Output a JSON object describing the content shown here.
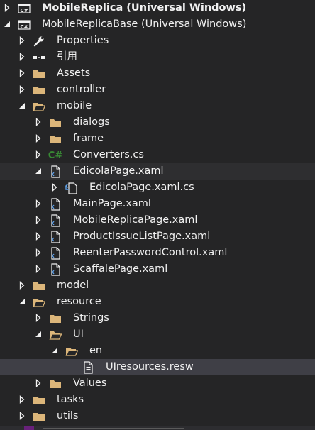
{
  "colors": {
    "background": "#252526",
    "text": "#f1f1f1",
    "folder": "#dcb67a",
    "csharp": "#68217a",
    "cs_file": "#388a34",
    "selected_row": "#3f3f46",
    "hover_row": "#2e2e30"
  },
  "tree": [
    {
      "label": "MobileReplica (Universal Windows)",
      "icon": "csharp-project-icon",
      "expander": "collapsed",
      "depth": 0,
      "bold": true
    },
    {
      "label": "MobileReplicaBase (Universal Windows)",
      "icon": "csharp-project-icon",
      "expander": "expanded",
      "depth": 0
    },
    {
      "label": "Properties",
      "icon": "wrench-icon",
      "expander": "collapsed",
      "depth": 1
    },
    {
      "label": "引用",
      "icon": "references-icon",
      "expander": "collapsed",
      "depth": 1
    },
    {
      "label": "Assets",
      "icon": "folder-icon",
      "expander": "collapsed",
      "depth": 1
    },
    {
      "label": "controller",
      "icon": "folder-icon",
      "expander": "collapsed",
      "depth": 1
    },
    {
      "label": "mobile",
      "icon": "folder-open-icon",
      "expander": "expanded",
      "depth": 1
    },
    {
      "label": "dialogs",
      "icon": "folder-icon",
      "expander": "collapsed",
      "depth": 2
    },
    {
      "label": "frame",
      "icon": "folder-icon",
      "expander": "collapsed",
      "depth": 2
    },
    {
      "label": "Converters.cs",
      "icon": "csharp-file-icon",
      "expander": "collapsed",
      "depth": 2
    },
    {
      "label": "EdicolaPage.xaml",
      "icon": "xaml-file-icon",
      "expander": "expanded",
      "depth": 2,
      "state": "hover"
    },
    {
      "label": "EdicolaPage.xaml.cs",
      "icon": "xaml-code-behind-icon",
      "expander": "collapsed",
      "depth": 3
    },
    {
      "label": "MainPage.xaml",
      "icon": "xaml-file-icon",
      "expander": "collapsed",
      "depth": 2
    },
    {
      "label": "MobileReplicaPage.xaml",
      "icon": "xaml-file-icon",
      "expander": "collapsed",
      "depth": 2
    },
    {
      "label": "ProductIssueListPage.xaml",
      "icon": "xaml-file-icon",
      "expander": "collapsed",
      "depth": 2
    },
    {
      "label": "ReenterPasswordControl.xaml",
      "icon": "xaml-file-icon",
      "expander": "collapsed",
      "depth": 2
    },
    {
      "label": "ScaffalePage.xaml",
      "icon": "xaml-file-icon",
      "expander": "collapsed",
      "depth": 2
    },
    {
      "label": "model",
      "icon": "folder-icon",
      "expander": "collapsed",
      "depth": 1
    },
    {
      "label": "resource",
      "icon": "folder-open-icon",
      "expander": "expanded",
      "depth": 1
    },
    {
      "label": "Strings",
      "icon": "folder-icon",
      "expander": "collapsed",
      "depth": 2
    },
    {
      "label": "UI",
      "icon": "folder-open-icon",
      "expander": "expanded",
      "depth": 2
    },
    {
      "label": "en",
      "icon": "folder-open-icon",
      "expander": "expanded",
      "depth": 3
    },
    {
      "label": "UIresources.resw",
      "icon": "resw-file-icon",
      "expander": "none",
      "depth": 4,
      "state": "selected"
    },
    {
      "label": "Values",
      "icon": "folder-icon",
      "expander": "collapsed",
      "depth": 2
    },
    {
      "label": "tasks",
      "icon": "folder-icon",
      "expander": "collapsed",
      "depth": 1
    },
    {
      "label": "utils",
      "icon": "folder-icon",
      "expander": "collapsed",
      "depth": 1
    }
  ]
}
